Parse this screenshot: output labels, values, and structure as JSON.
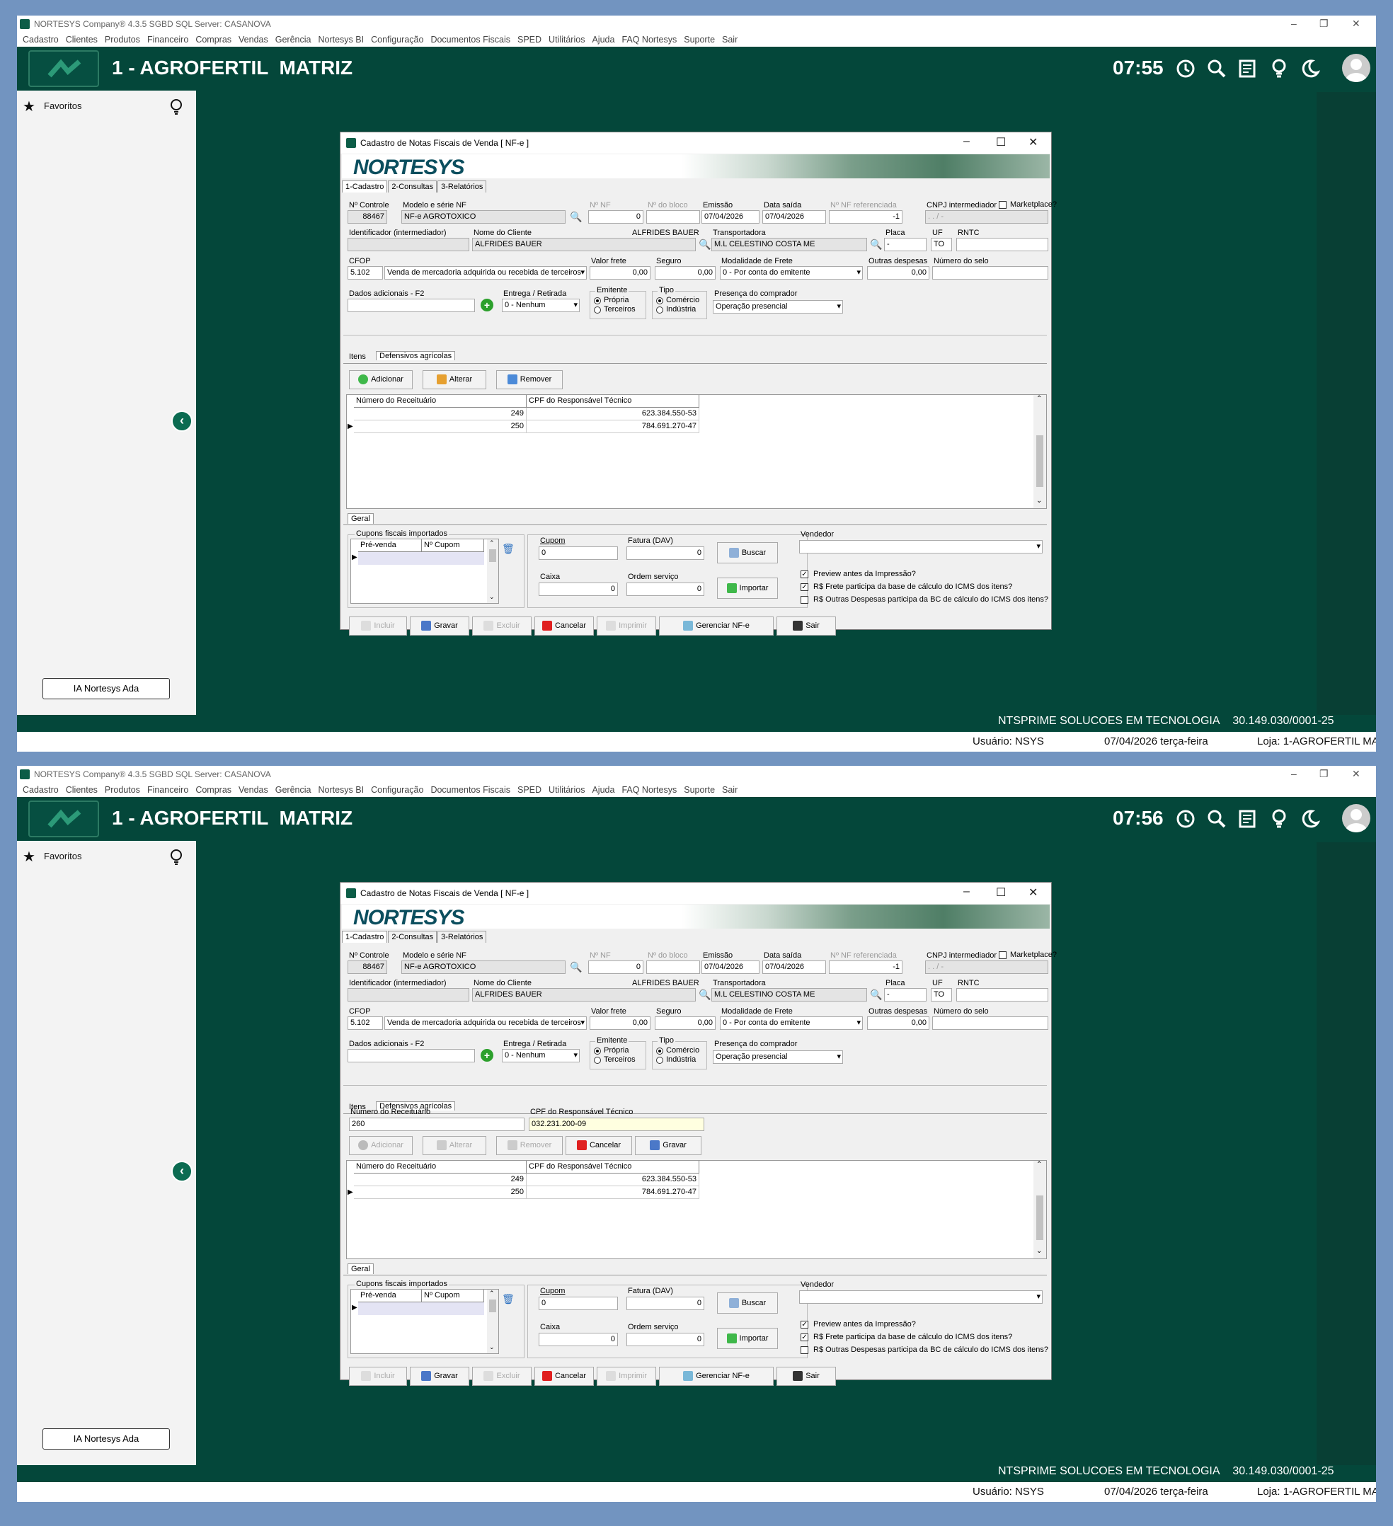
{
  "app": {
    "window_title": "NORTESYS Company® 4.3.5 SGBD SQL Server: CASANOVA",
    "menu": [
      "Cadastro",
      "Clientes",
      "Produtos",
      "Financeiro",
      "Compras",
      "Vendas",
      "Gerência",
      "Nortesys BI",
      "Configuração",
      "Documentos Fiscais",
      "SPED",
      "Utilitários",
      "Ajuda",
      "FAQ Nortesys",
      "Suporte",
      "Sair"
    ],
    "company_title": "1 - AGROFERTIL  MATRIZ",
    "sidebar": {
      "favorites": "Favoritos",
      "ai_button": "IA Nortesys Ada"
    },
    "footer": {
      "company": "NTSPRIME SOLUCOES EM TECNOLOGIA",
      "cnpj": "30.149.030/0001-25"
    },
    "status": {
      "user": "Usuário: NSYS",
      "date": "07/04/2026 terça-feira",
      "store": "Loja: 1-AGROFERTIL MA"
    }
  },
  "screens": [
    {
      "clock": "07:55"
    },
    {
      "clock": "07:56"
    }
  ],
  "dialog": {
    "title": "Cadastro de Notas Fiscais de Venda [ NF-e ]",
    "logo": "NORTESYS",
    "tabs": [
      "1-Cadastro",
      "2-Consultas",
      "3-Relatórios"
    ],
    "labels": {
      "controle": "Nº Controle",
      "modelo": "Modelo e série NF",
      "nf": "Nº  NF",
      "bloco": "Nº do bloco",
      "emissao": "Emissão",
      "saida": "Data saída",
      "nfref": "Nº  NF referenciada",
      "cnpj": "CNPJ intermediador",
      "marketplace": "Marketplace?",
      "identificador": "Identificador (intermediador)",
      "cliente": "Nome do Cliente",
      "transportadora": "Transportadora",
      "placa": "Placa",
      "uf": "UF",
      "rntc": "RNTC",
      "cfop": "CFOP",
      "valor_frete": "Valor frete",
      "seguro": "Seguro",
      "modalidade": "Modalidade de Frete",
      "outras": "Outras despesas",
      "selo": "Número do selo",
      "dados": "Dados adicionais - F2",
      "entrega": "Entrega / Retirada",
      "emitente": "Emitente",
      "propria": "Própria",
      "terceiros": "Terceiros",
      "tipo": "Tipo",
      "comercio": "Comércio",
      "industria": "Indústria",
      "presenca": "Presença do comprador"
    },
    "values": {
      "controle": "88467",
      "modelo": "NF-e AGROTOXICO",
      "nf": "0",
      "emissao": "07/04/2026",
      "saida": "07/04/2026",
      "nfref": "-1",
      "cnpj": "  .   .   /    -",
      "cliente_side": "ALFRIDES BAUER",
      "cliente": "ALFRIDES BAUER",
      "transportadora": "M.L CELESTINO COSTA ME",
      "placa": "-",
      "uf": "TO",
      "cfop": "5.102",
      "cfop_desc": "Venda de mercadoria adquirida ou recebida de terceiros",
      "valor_frete": "0,00",
      "seguro": "0,00",
      "modalidade": "0 - Por conta do emitente",
      "outras": "0,00",
      "entrega": "0 - Nenhum",
      "presenca": "Operação presencial"
    },
    "subtabs": [
      "Itens",
      "Defensivos agrícolas"
    ],
    "item_buttons": {
      "add": "Adicionar",
      "edit": "Alterar",
      "remove": "Remover",
      "cancel": "Cancelar",
      "save": "Gravar"
    },
    "edit_form": {
      "receituario_label": "Número do Receituário",
      "cpf_label": "CPF do Responsável Técnico",
      "receituario": "260",
      "cpf": "032.231.200-09"
    },
    "grid": {
      "headers": [
        "Número do Receituário",
        "CPF do Responsável Técnico"
      ],
      "rows": [
        [
          "249",
          "623.384.550-53"
        ],
        [
          "250",
          "784.691.270-47"
        ]
      ]
    },
    "geral": {
      "tab": "Geral",
      "cupons_group": "Cupons fiscais importados",
      "cupons_headers": [
        "Pré-venda",
        "Nº Cupom"
      ],
      "cupom": "Cupom",
      "fatura": "Fatura (DAV)",
      "caixa": "Caixa",
      "ordem": "Ordem serviço",
      "cupom_val": "0",
      "fatura_val": "0",
      "caixa_val": "0",
      "ordem_val": "0",
      "buscar": "Buscar",
      "importar": "Importar",
      "vendedor": "Vendedor",
      "chk1": "Preview antes da Impressão?",
      "chk2": "R$ Frete participa da base de cálculo do ICMS dos itens?",
      "chk3": "R$ Outras Despesas participa da BC de cálculo do ICMS dos itens?"
    },
    "bottom": [
      "Incluir",
      "Gravar",
      "Excluir",
      "Cancelar",
      "Imprimir",
      "Gerenciar NF-e",
      "Sair"
    ]
  },
  "colors": {
    "app_bg": "#04473a",
    "brand": "#0b4e5e",
    "accent": "#0b6b51"
  }
}
